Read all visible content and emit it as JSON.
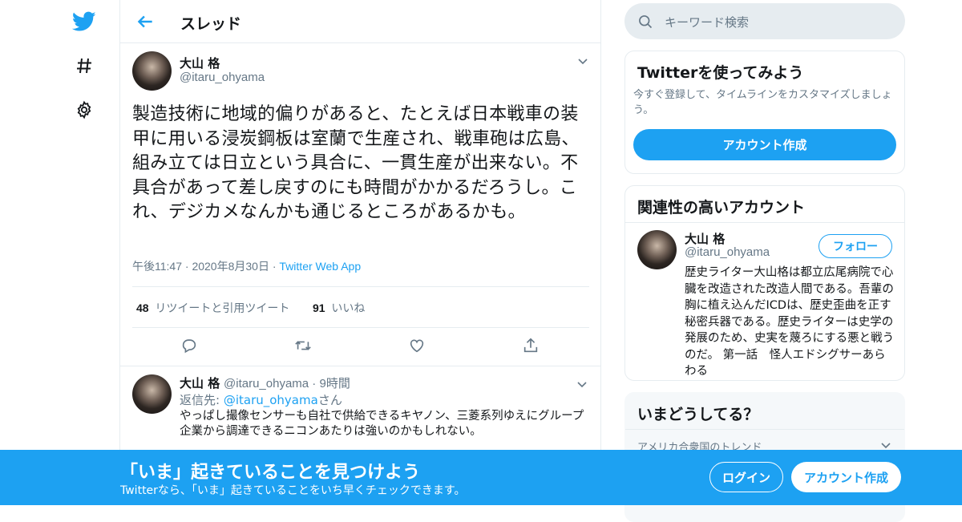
{
  "colors": {
    "accent": "#1da1f2",
    "text": "#14171a",
    "muted": "#657786",
    "border": "#e6ecf0"
  },
  "nav": {
    "icons": [
      "twitter-logo",
      "hashtag-icon",
      "gear-icon"
    ]
  },
  "header": {
    "title": "スレッド"
  },
  "tweet": {
    "name": "大山 格",
    "handle": "@itaru_ohyama",
    "text": "製造技術に地域的偏りがあると、たとえば日本戦車の装甲に用いる浸炭鋼板は室蘭で生産され、戦車砲は広島、組み立ては日立という具合に、一貫生産が出来ない。不具合があって差し戻すのにも時間がかかるだろうし。これ、デジカメなんかも通じるところがあるかも。",
    "time": "午後11:47",
    "date": "2020年8月30日",
    "source": "Twitter Web App",
    "retweets_count": "48",
    "retweets_label": "リツイートと引用ツイート",
    "likes_count": "91",
    "likes_label": "いいね"
  },
  "reply": {
    "name": "大山 格",
    "handle": "@itaru_ohyama",
    "time": "9時間",
    "reply_to_label": "返信先: ",
    "reply_to_handle": "@itaru_ohyama",
    "reply_to_suffix": "さん",
    "text": "やっぱし撮像センサーも自社で供給できるキヤノン、三菱系列ゆえにグループ企業から調達できるニコンあたりは強いのかもしれない。"
  },
  "sidebar": {
    "search_placeholder": "キーワード検索",
    "signup_card": {
      "title": "Twitterを使ってみよう",
      "desc": "今すぐ登録して、タイムラインをカスタマイズしましょう。",
      "button": "アカウント作成"
    },
    "related": {
      "title": "関連性の高いアカウント",
      "name": "大山 格",
      "handle": "@itaru_ohyama",
      "follow": "フォロー",
      "bio": "歴史ライター大山格は都立広尾病院で心臓を改造された改造人間である。吾輩の胸に植え込んだICDは、歴史歪曲を正す秘密兵器である。歴史ライターは史学の発展のため、史実を蔑ろにする悪と戦うのだ。 第一話　怪人エドシグサーあらわる"
    },
    "trends": {
      "title": "いまどうしてる？",
      "subtitle": "アメリカ合衆国のトレンド"
    }
  },
  "banner": {
    "title": "「いま」起きていることを見つけよう",
    "subtitle": "Twitterなら、「いま」起きていることをいち早くチェックできます。",
    "login": "ログイン",
    "signup": "アカウント作成"
  }
}
